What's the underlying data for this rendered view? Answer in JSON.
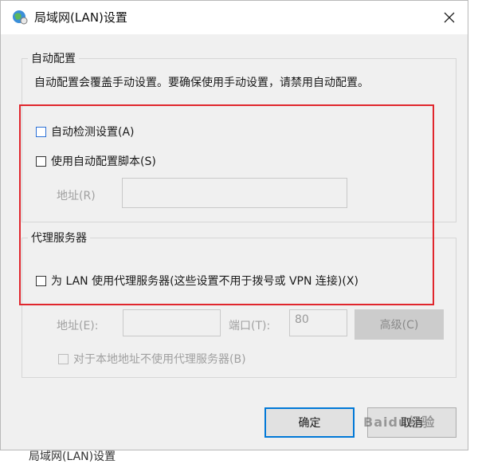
{
  "window": {
    "title": "局域网(LAN)设置",
    "footer_echo": "局域网(LAN)设置"
  },
  "auto_config": {
    "legend": "自动配置",
    "note": "自动配置会覆盖手动设置。要确保使用手动设置，请禁用自动配置。",
    "auto_detect_label": "自动检测设置(A)",
    "auto_detect_checked": false,
    "use_script_label": "使用自动配置脚本(S)",
    "use_script_checked": false,
    "script_address_label": "地址(R)",
    "script_address_value": ""
  },
  "proxy": {
    "legend": "代理服务器",
    "use_proxy_label": "为 LAN 使用代理服务器(这些设置不用于拨号或 VPN 连接)(X)",
    "use_proxy_checked": false,
    "address_label": "地址(E):",
    "address_value": "",
    "port_label": "端口(T):",
    "port_value": "80",
    "advanced_label": "高级(C)",
    "bypass_label": "对于本地地址不使用代理服务器(B)",
    "bypass_checked": false
  },
  "buttons": {
    "ok": "确定",
    "cancel": "取消"
  },
  "watermark": "Baidu经验",
  "colors": {
    "highlight_box": "#e0262d",
    "primary_border": "#0078d7"
  }
}
